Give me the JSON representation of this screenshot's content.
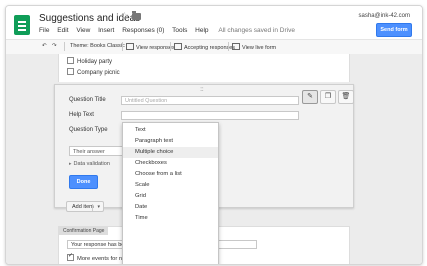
{
  "header": {
    "title": "Suggestions and ideas",
    "email": "sasha@ink-42.com",
    "send_label": "Send form",
    "star_icon": "star-icon",
    "folder_icon": "folder-icon",
    "app_icon": "forms-app-icon"
  },
  "menu": {
    "items": [
      "File",
      "Edit",
      "View",
      "Insert",
      "Responses (0)",
      "Tools",
      "Help"
    ],
    "saved_status": "All changes saved in Drive"
  },
  "toolbar": {
    "theme": "Theme: Books Classic",
    "view_responses": "View responses",
    "accepting": "Accepting responses",
    "view_live": "View live form"
  },
  "checkboxes": {
    "options": [
      "Holiday party",
      "Company picnic"
    ]
  },
  "editor": {
    "question_title_label": "Question Title",
    "question_title_placeholder": "Untitled Question",
    "help_text_label": "Help Text",
    "question_type_label": "Question Type",
    "answer_placeholder": "Their answer",
    "data_validation": "Data validation",
    "done_label": "Done",
    "grip": "::::"
  },
  "question_type_menu": {
    "items": [
      "Text",
      "Paragraph text",
      "Multiple choice",
      "Checkboxes",
      "Choose from a list",
      "Scale",
      "Grid",
      "Date",
      "Time"
    ],
    "highlighted": "Multiple choice"
  },
  "add_item": {
    "label": "Add item"
  },
  "confirmation": {
    "title": "Confirmation Page",
    "message": "Your response has been recorded.",
    "more_events_label": "More events for new team members"
  },
  "colors": {
    "brand_green": "#0f9d58",
    "primary_blue": "#4d90fe"
  }
}
